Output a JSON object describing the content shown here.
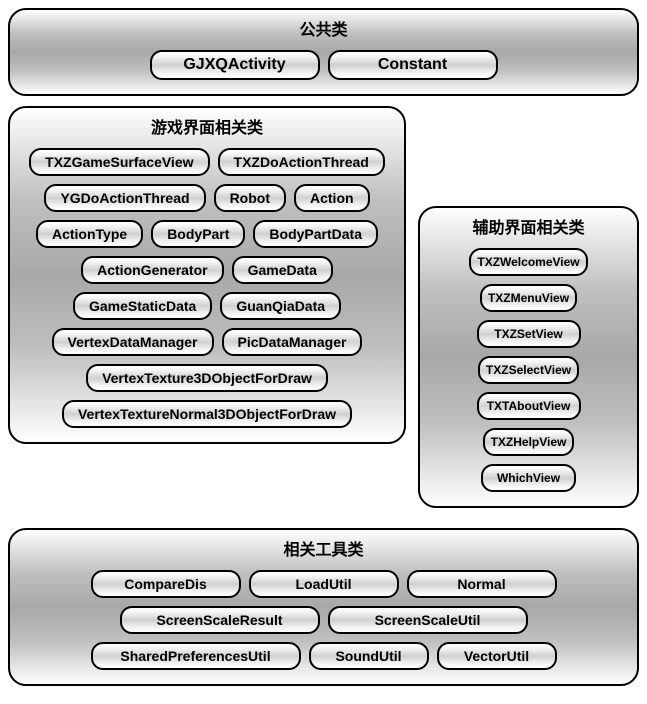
{
  "publicPanel": {
    "title": "公共类",
    "items": [
      "GJXQActivity",
      "Constant"
    ]
  },
  "gamePanel": {
    "title": "游戏界面相关类",
    "items": [
      "TXZGameSurfaceView",
      "TXZDoActionThread",
      "YGDoActionThread",
      "Robot",
      "Action",
      "ActionType",
      "BodyPart",
      "BodyPartData",
      "ActionGenerator",
      "GameData",
      "GameStaticData",
      "GuanQiaData",
      "VertexDataManager",
      "PicDataManager",
      "VertexTexture3DObjectForDraw",
      "VertexTextureNormal3DObjectForDraw"
    ]
  },
  "auxPanel": {
    "title": "辅助界面相关类",
    "items": [
      "TXZWelcomeView",
      "TXZMenuView",
      "TXZSetView",
      "TXZSelectView",
      "TXTAboutView",
      "TXZHelpView",
      "WhichView"
    ]
  },
  "toolPanel": {
    "title": "相关工具类",
    "items": [
      "CompareDis",
      "LoadUtil",
      "Normal",
      "ScreenScaleResult",
      "ScreenScaleUtil",
      "SharedPreferencesUtil",
      "SoundUtil",
      "VectorUtil"
    ]
  }
}
